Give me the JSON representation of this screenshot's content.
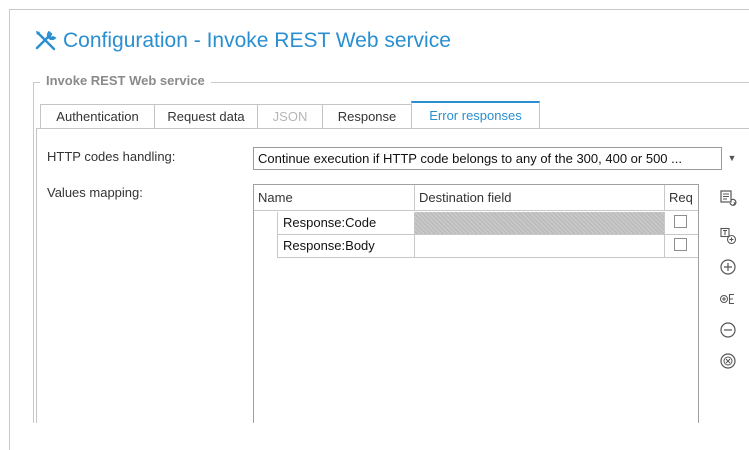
{
  "window": {
    "title": "Configuration - Invoke REST Web service",
    "title_icon": "tools-icon"
  },
  "group": {
    "title": "Invoke REST Web service"
  },
  "tabs": [
    {
      "label": "Authentication",
      "state": "normal"
    },
    {
      "label": "Request data",
      "state": "normal"
    },
    {
      "label": "JSON",
      "state": "disabled"
    },
    {
      "label": "Response",
      "state": "normal"
    },
    {
      "label": "Error responses",
      "state": "active"
    }
  ],
  "http_codes": {
    "label": "HTTP codes handling:",
    "selected": "Continue execution if HTTP code belongs to any of the 300, 400 or 500 ..."
  },
  "values_mapping": {
    "label": "Values mapping:",
    "columns": [
      "Name",
      "Destination field",
      "Req"
    ],
    "rows": [
      {
        "name": "Response:Code",
        "destination": "",
        "req": false,
        "destination_state": "disabled"
      },
      {
        "name": "Response:Body",
        "destination": "",
        "req": false,
        "destination_state": "enabled"
      }
    ]
  },
  "toolbar": [
    {
      "icon": "auto-map-icon"
    },
    {
      "icon": "add-text-icon"
    },
    {
      "icon": "add-icon"
    },
    {
      "icon": "add-expression-icon"
    },
    {
      "icon": "remove-icon"
    },
    {
      "icon": "clear-all-icon"
    }
  ],
  "colors": {
    "accent": "#2a8fd1",
    "disabled_cell": "#bdbdbd"
  }
}
